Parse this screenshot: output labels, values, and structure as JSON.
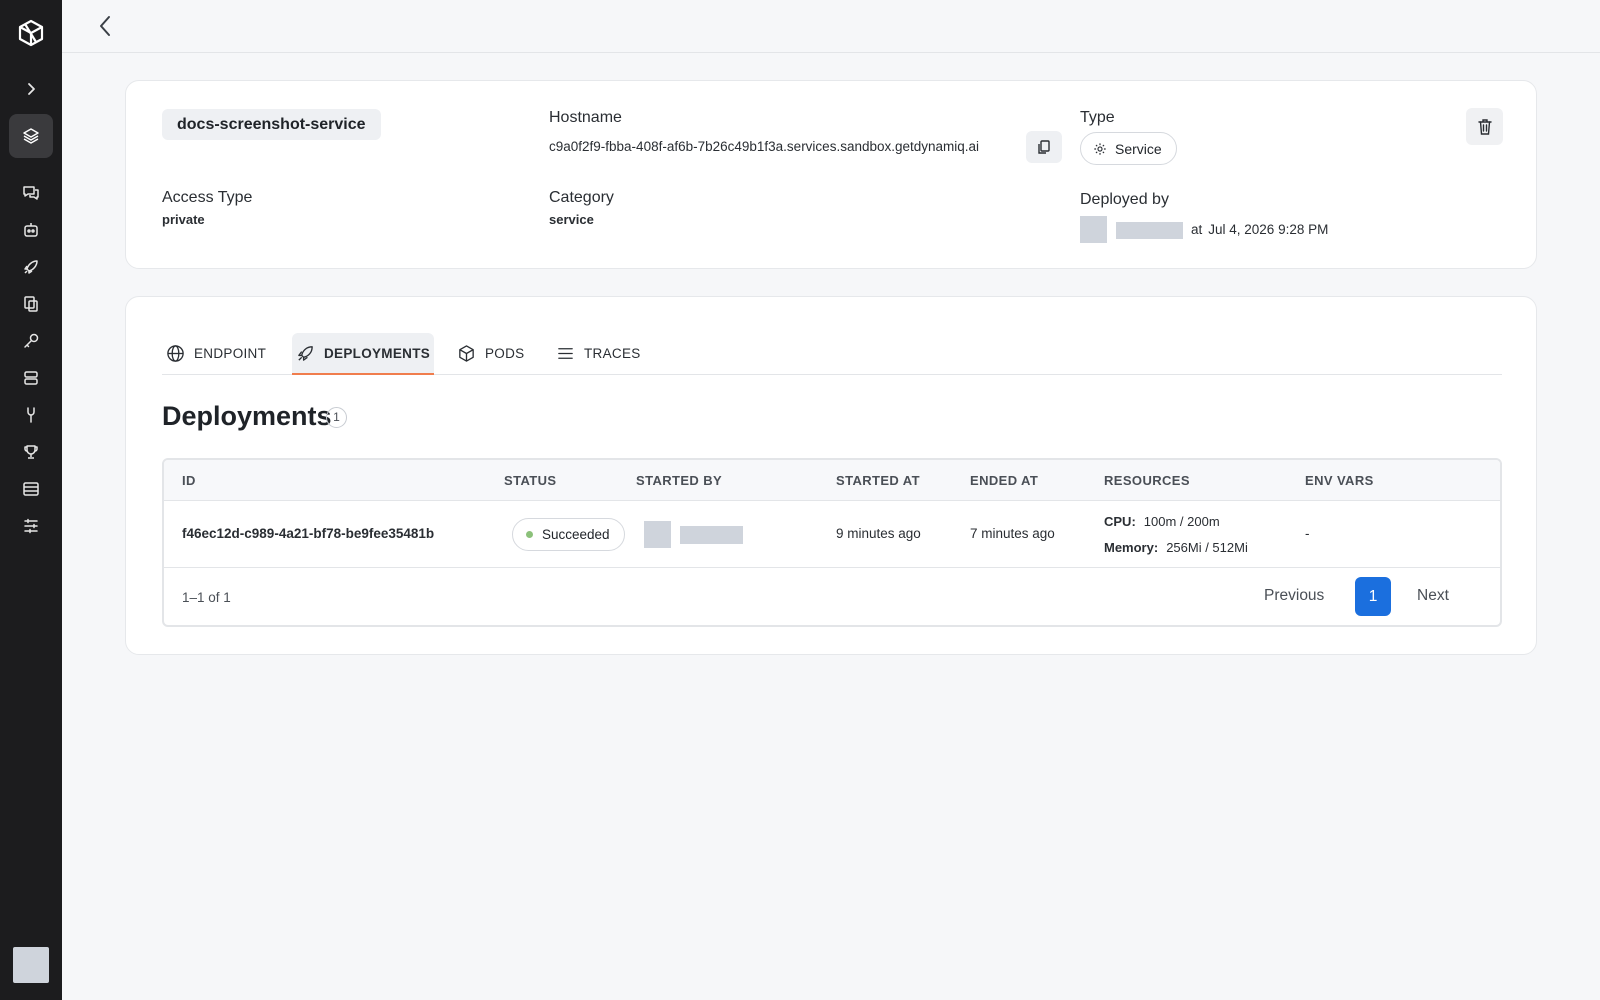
{
  "sidebar": {
    "items": [
      {
        "name": "expand",
        "icon": "chevron-right-icon"
      },
      {
        "name": "services",
        "icon": "layers-icon",
        "active": true
      },
      {
        "name": "chat",
        "icon": "chat-icon"
      },
      {
        "name": "bots",
        "icon": "bot-icon"
      },
      {
        "name": "deploy",
        "icon": "rocket-icon"
      },
      {
        "name": "knowledge",
        "icon": "documents-icon"
      },
      {
        "name": "keys",
        "icon": "key-icon"
      },
      {
        "name": "storage",
        "icon": "server-icon"
      },
      {
        "name": "integrations",
        "icon": "tool-icon"
      },
      {
        "name": "evals",
        "icon": "trophy-icon"
      },
      {
        "name": "logs",
        "icon": "table-icon"
      },
      {
        "name": "settings",
        "icon": "sliders-icon"
      }
    ]
  },
  "service": {
    "name": "docs-screenshot-service",
    "hostname_label": "Hostname",
    "hostname": "c9a0f2f9-fbba-408f-af6b-7b26c49b1f3a.services.sandbox.getdynamiq.ai",
    "type_label": "Type",
    "type_value": "Service",
    "access_type_label": "Access Type",
    "access_type_value": "private",
    "category_label": "Category",
    "category_value": "service",
    "deployed_by_label": "Deployed by",
    "deployed_at_prefix": "at",
    "deployed_at": "Jul 4, 2026 9:28 PM"
  },
  "tabs": [
    {
      "label": "ENDPOINT",
      "icon": "globe-icon"
    },
    {
      "label": "DEPLOYMENTS",
      "icon": "rocket-icon",
      "active": true
    },
    {
      "label": "PODS",
      "icon": "box-icon"
    },
    {
      "label": "TRACES",
      "icon": "list-icon"
    }
  ],
  "deployments": {
    "title": "Deployments",
    "count": "1",
    "columns": [
      "ID",
      "STATUS",
      "STARTED BY",
      "STARTED AT",
      "ENDED AT",
      "RESOURCES",
      "ENV VARS"
    ],
    "rows": [
      {
        "id": "f46ec12d-c989-4a21-bf78-be9fee35481b",
        "status": "Succeeded",
        "started_at": "9 minutes ago",
        "ended_at": "7 minutes ago",
        "cpu_label": "CPU:",
        "cpu_value": "100m / 200m",
        "memory_label": "Memory:",
        "memory_value": "256Mi / 512Mi",
        "env_vars": "-"
      }
    ],
    "range": "1–1 of 1",
    "prev_label": "Previous",
    "page": "1",
    "next_label": "Next"
  },
  "colors": {
    "sidebar_bg": "#1c1c1e",
    "active_tab_underline": "#f07d4d",
    "pager_active": "#1b6fde",
    "status_success": "#8cc17a"
  }
}
